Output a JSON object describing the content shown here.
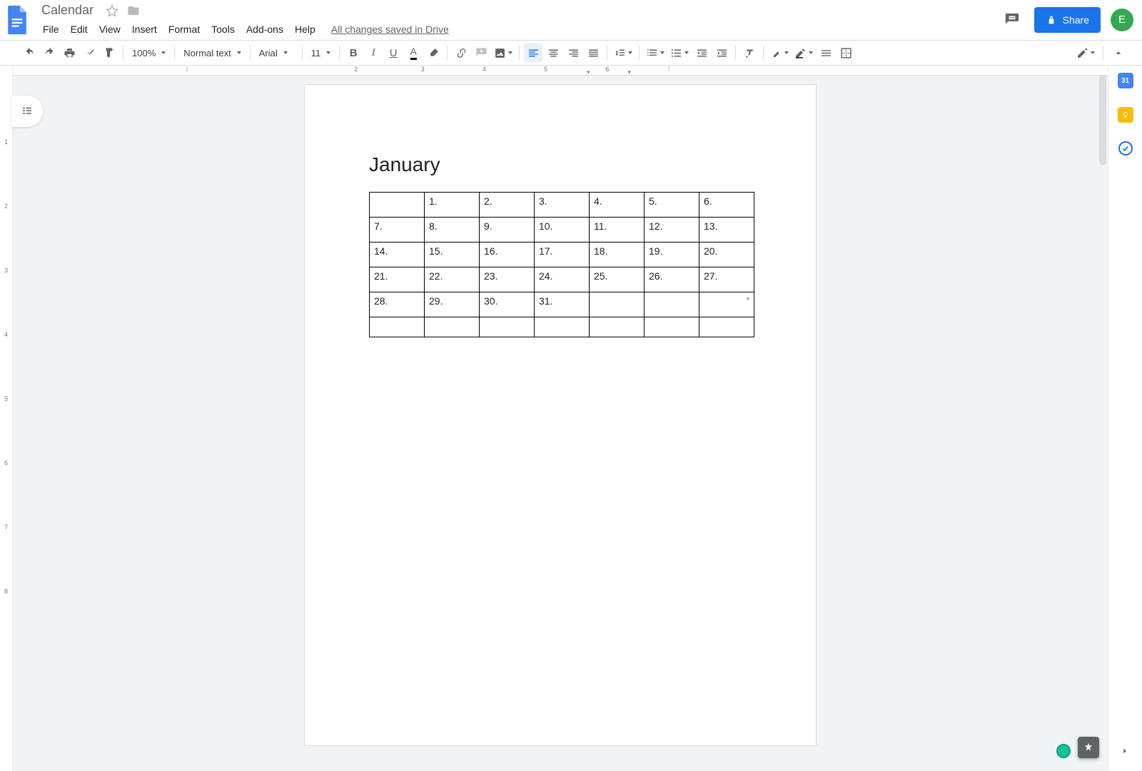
{
  "document": {
    "title": "Calendar"
  },
  "menus": [
    "File",
    "Edit",
    "View",
    "Insert",
    "Format",
    "Tools",
    "Add-ons",
    "Help"
  ],
  "save_status": "All changes saved in Drive",
  "share": {
    "label": "Share"
  },
  "avatar": {
    "initial": "E"
  },
  "toolbar": {
    "zoom": "100%",
    "style": "Normal text",
    "font": "Arial",
    "size": "11"
  },
  "ruler": {
    "numbers": [
      "1",
      "2",
      "3",
      "4",
      "5",
      "6",
      "7"
    ]
  },
  "left_ruler": {
    "ticks": [
      "1",
      "2",
      "3",
      "4",
      "5",
      "6",
      "7",
      "8"
    ]
  },
  "content": {
    "heading": "January",
    "calendar_rows": [
      [
        "",
        "1.",
        "2.",
        "3.",
        "4.",
        "5.",
        "6."
      ],
      [
        "7.",
        "8.",
        "9.",
        "10.",
        "11.",
        "12.",
        "13."
      ],
      [
        "14.",
        "15.",
        "16.",
        "17.",
        "18.",
        "19.",
        "20."
      ],
      [
        "21.",
        "22.",
        "23.",
        "24.",
        "25.",
        "26.",
        "27."
      ],
      [
        "28.",
        "29.",
        "30.",
        "31.",
        "",
        "",
        ""
      ],
      [
        "",
        "",
        "",
        "",
        "",
        "",
        ""
      ]
    ]
  },
  "side_apps": {
    "calendar_label": "31"
  }
}
